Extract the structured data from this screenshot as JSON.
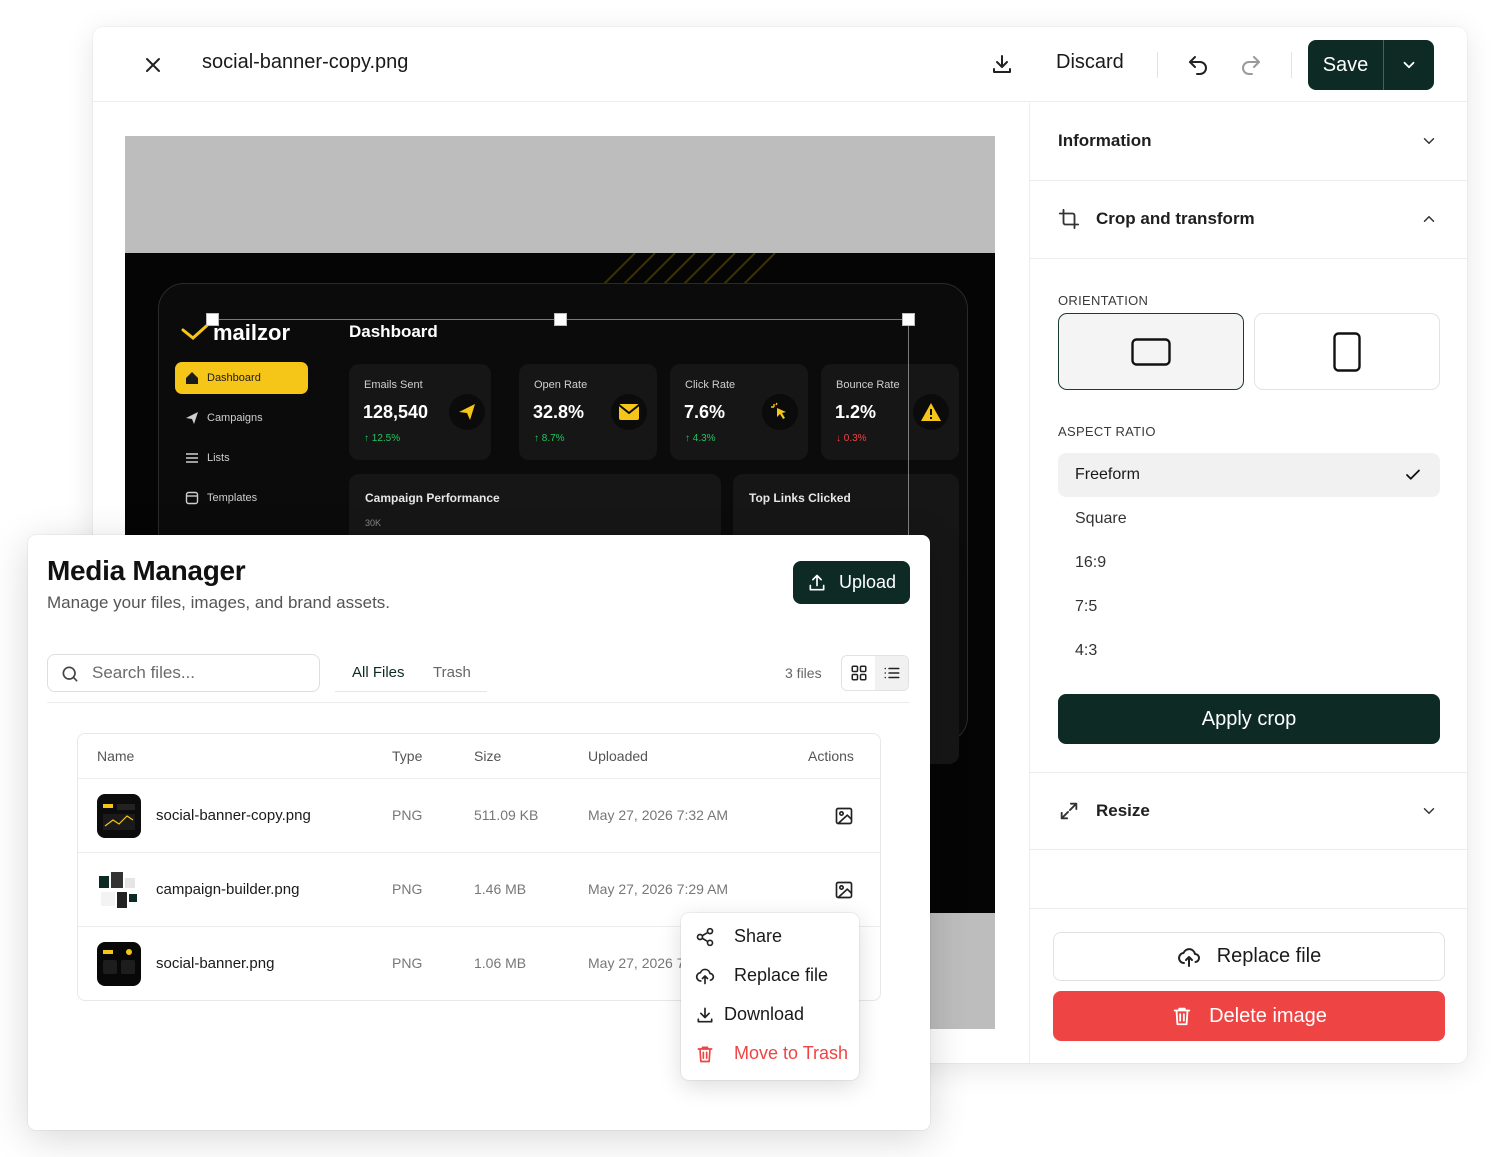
{
  "editor": {
    "file_name": "social-banner-copy.png",
    "discard_label": "Discard",
    "save_label": "Save"
  },
  "sidebar": {
    "information_label": "Information",
    "crop_label": "Crop and transform",
    "orientation_label": "ORIENTATION",
    "aspect_label": "ASPECT RATIO",
    "aspect_ratios": [
      "Freeform",
      "Square",
      "16:9",
      "7:5",
      "4:3"
    ],
    "aspect_selected": "Freeform",
    "apply_label": "Apply crop",
    "resize_label": "Resize",
    "replace_label": "Replace file",
    "delete_label": "Delete image"
  },
  "preview": {
    "brand": "mailzor",
    "page_title": "Dashboard",
    "nav": [
      "Dashboard",
      "Campaigns",
      "Lists",
      "Templates"
    ],
    "cards": [
      {
        "label": "Emails Sent",
        "value": "128,540",
        "delta": "↑ 12.5%",
        "trend": "up"
      },
      {
        "label": "Open Rate",
        "value": "32.8%",
        "delta": "↑ 8.7%",
        "trend": "up"
      },
      {
        "label": "Click Rate",
        "value": "7.6%",
        "delta": "↑ 4.3%",
        "trend": "up"
      },
      {
        "label": "Bounce Rate",
        "value": "1.2%",
        "delta": "↓ 0.3%",
        "trend": "down"
      }
    ],
    "panel_campaign": "Campaign Performance",
    "panel_links": "Top Links Clicked",
    "y_tick": "30K"
  },
  "media_manager": {
    "title": "Media Manager",
    "subtitle": "Manage your files, images, and brand assets.",
    "upload_label": "Upload",
    "search_placeholder": "Search files...",
    "tabs": [
      "All Files",
      "Trash"
    ],
    "active_tab": "All Files",
    "file_count": "3 files",
    "columns": [
      "Name",
      "Type",
      "Size",
      "Uploaded",
      "Actions"
    ],
    "rows": [
      {
        "name": "social-banner-copy.png",
        "type": "PNG",
        "size": "511.09 KB",
        "uploaded": "May 27, 2026 7:32 AM"
      },
      {
        "name": "campaign-builder.png",
        "type": "PNG",
        "size": "1.46 MB",
        "uploaded": "May 27, 2026 7:29 AM"
      },
      {
        "name": "social-banner.png",
        "type": "PNG",
        "size": "1.06 MB",
        "uploaded": "May 27, 2026 7"
      }
    ],
    "context_menu": [
      "Share",
      "Replace file",
      "Download",
      "Move to Trash"
    ]
  },
  "colors": {
    "primary": "#0d2b24",
    "danger": "#ef4444",
    "accent_yellow": "#f5c518",
    "positive": "#22c55e"
  }
}
